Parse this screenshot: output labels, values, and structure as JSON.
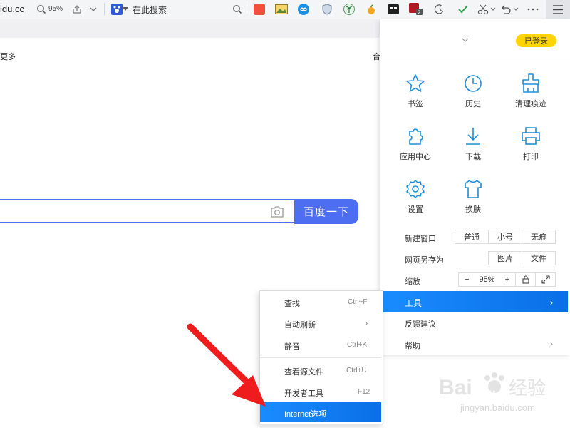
{
  "toolbar": {
    "url_fragment": "idu.cc",
    "zoom": "95%",
    "search_engine_label": "在此搜索"
  },
  "page": {
    "more_link": "更多",
    "right_link_fragment": "合",
    "search_button": "百度一下"
  },
  "main_menu": {
    "login_badge": "已登录",
    "grid": [
      {
        "label": "书签",
        "icon": "star-icon"
      },
      {
        "label": "历史",
        "icon": "history-clock-icon"
      },
      {
        "label": "清理痕迹",
        "icon": "broom-icon"
      },
      {
        "label": "应用中心",
        "icon": "puzzle-icon"
      },
      {
        "label": "下载",
        "icon": "download-icon"
      },
      {
        "label": "打印",
        "icon": "printer-icon"
      },
      {
        "label": "设置",
        "icon": "gear-icon"
      },
      {
        "label": "换肤",
        "icon": "shirt-icon"
      }
    ],
    "new_window": {
      "label": "新建窗口",
      "options": [
        "普通",
        "小号",
        "无痕"
      ]
    },
    "save_page": {
      "label": "网页另存为",
      "options": [
        "图片",
        "文件"
      ]
    },
    "zoom_row": {
      "label": "缩放",
      "minus": "−",
      "value": "95%",
      "plus": "+"
    },
    "tools_label": "工具",
    "feedback_label": "反馈建议",
    "help_label": "帮助",
    "chevron": "›"
  },
  "sub_menu": {
    "items": [
      {
        "label": "查找",
        "shortcut": "Ctrl+F"
      },
      {
        "label": "自动刷新",
        "shortcut": "›"
      },
      {
        "label": "静音",
        "shortcut": "Ctrl+K"
      },
      {
        "label": "查看源文件",
        "shortcut": "Ctrl+U"
      },
      {
        "label": "开发者工具",
        "shortcut": "F12"
      },
      {
        "label": "Internet选项",
        "shortcut": ""
      }
    ]
  },
  "watermark": {
    "brand": "Bai",
    "brand2": "du",
    "suffix": "经验",
    "url": "jingyan.baidu.com"
  },
  "colors": {
    "accent_blue": "#4e6ef2",
    "menu_highlight": "#1a8cff",
    "menu_icon": "#1f8fd8",
    "login_badge": "#ffd400",
    "arrow_red": "#ee1c1c"
  }
}
